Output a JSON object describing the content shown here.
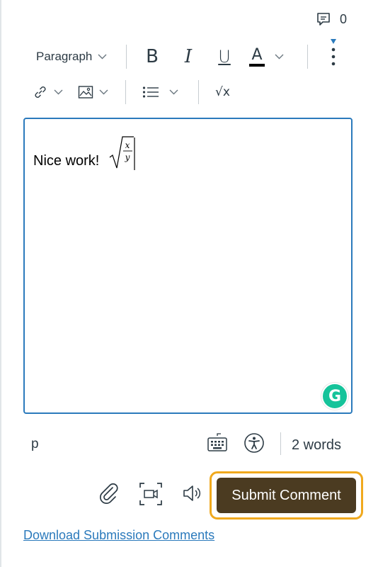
{
  "comments": {
    "count": "0"
  },
  "toolbar": {
    "block_format": "Paragraph",
    "bold_glyph": "B",
    "italic_glyph": "I",
    "underline_glyph": "U",
    "text_color_glyph": "A",
    "equation_glyph": "√x",
    "text_color_value": "#000000"
  },
  "editor": {
    "content_text": "Nice work!",
    "math": {
      "numerator": "x",
      "denominator": "y"
    }
  },
  "status_bar": {
    "element_path": "p",
    "word_count": "2 words"
  },
  "grammarly": {
    "glyph": "G"
  },
  "actions": {
    "submit_label": "Submit Comment",
    "download_link": "Download Submission Comments"
  },
  "colors": {
    "accent": "#2b7abc",
    "submit_bg": "#4b3b21",
    "focus_ring": "#f0a91e",
    "grammarly": "#15c39a"
  }
}
